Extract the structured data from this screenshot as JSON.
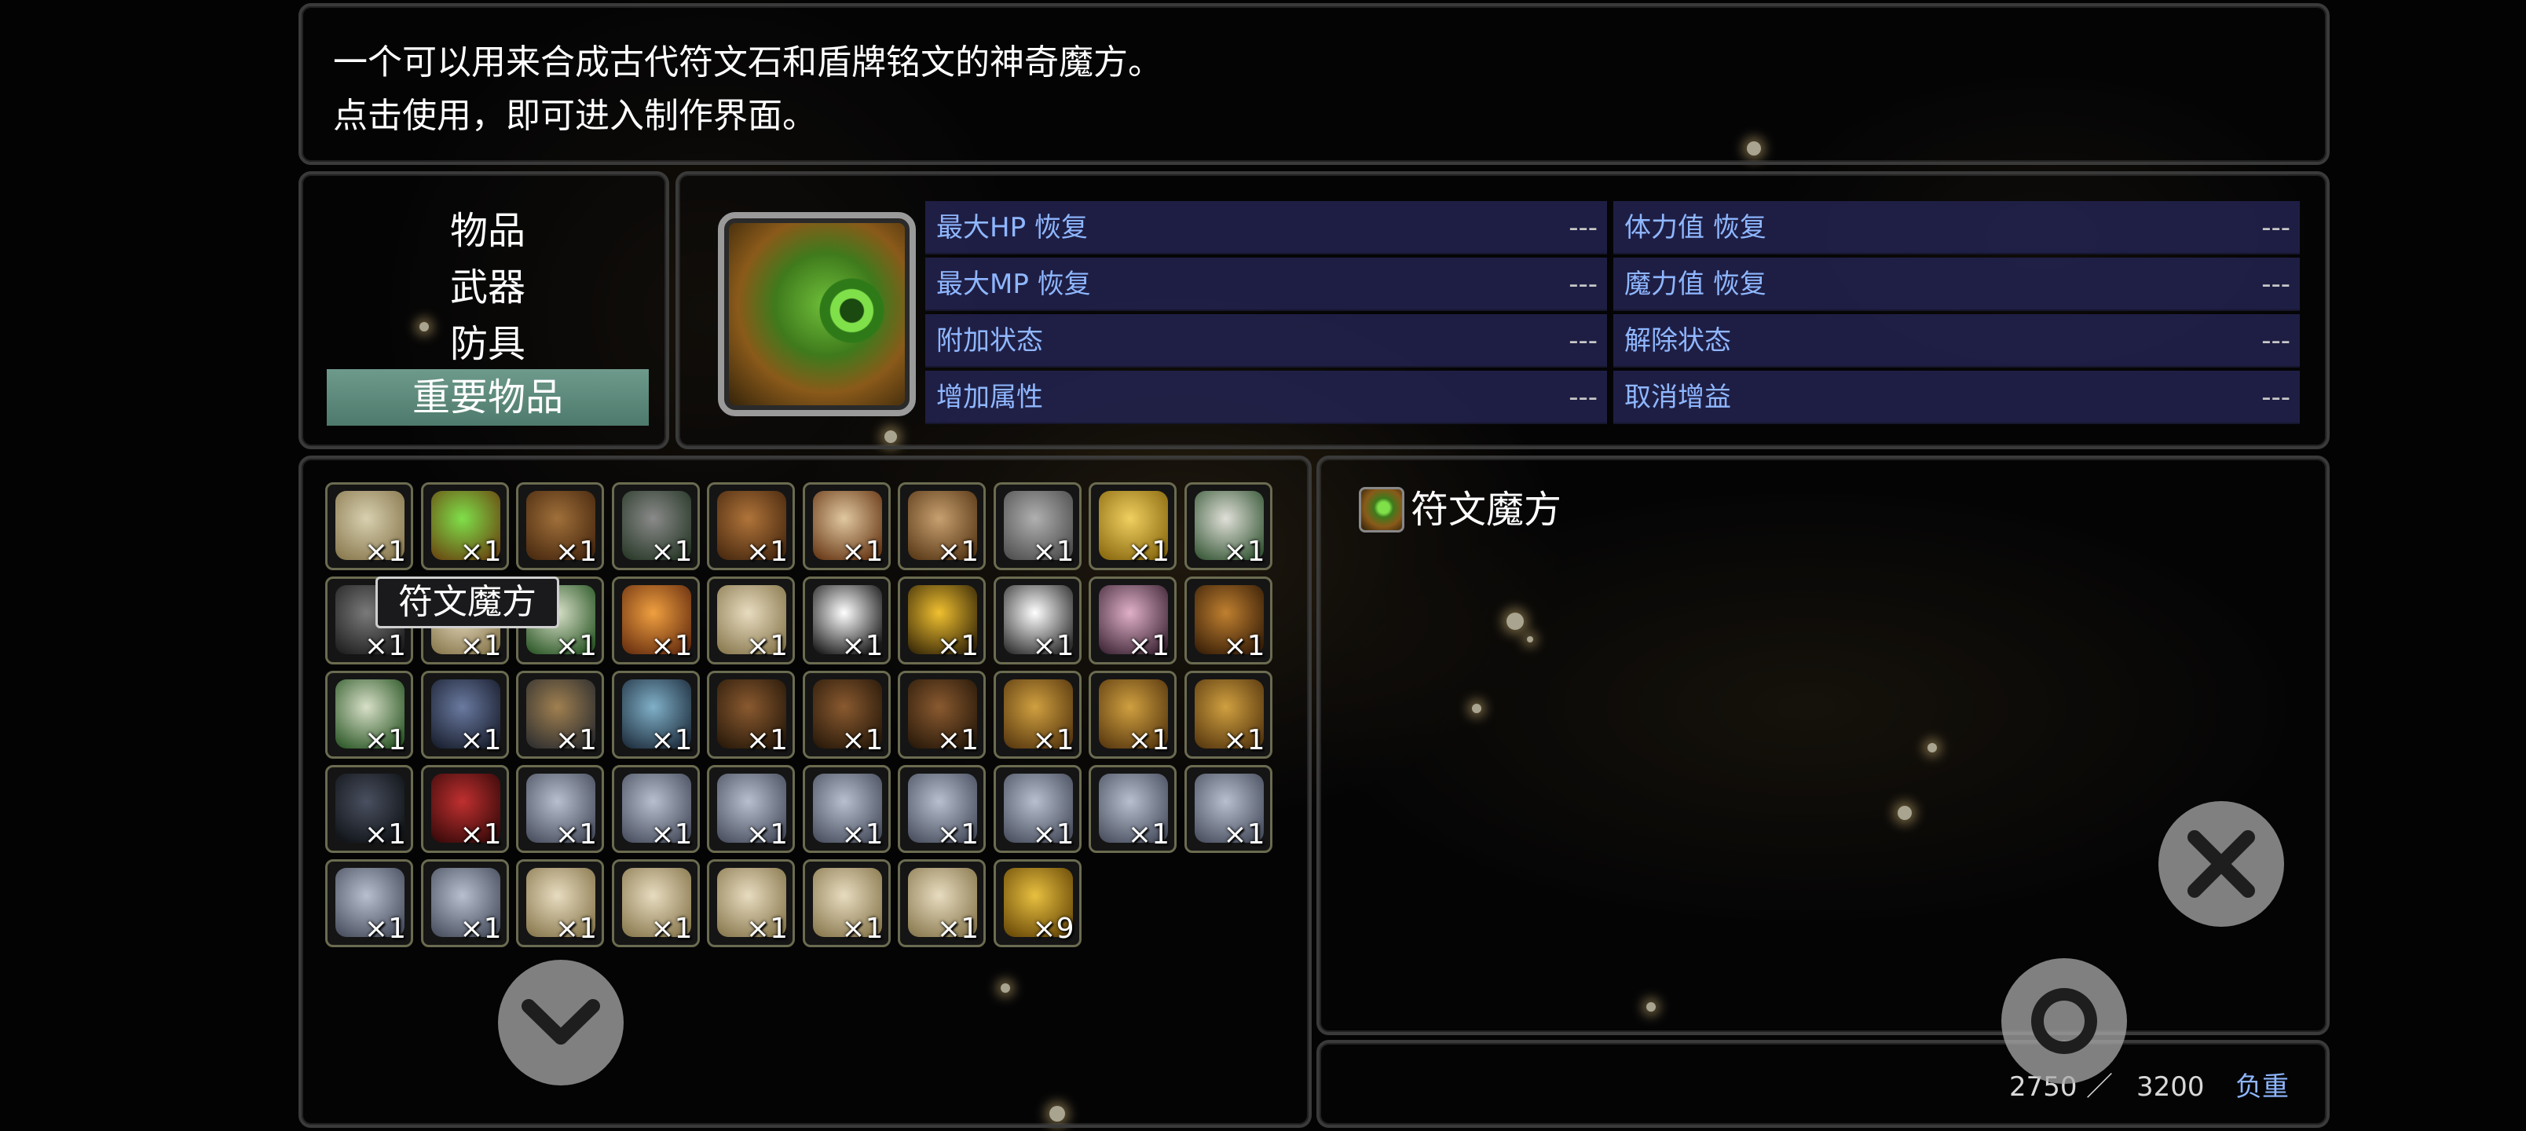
{
  "description": {
    "line1": "一个可以用来合成古代符文石和盾牌铭文的神奇魔方。",
    "line2": "点击使用，即可进入制作界面。"
  },
  "categories": [
    {
      "label": "物品",
      "active": false
    },
    {
      "label": "武器",
      "active": false
    },
    {
      "label": "防具",
      "active": false
    },
    {
      "label": "重要物品",
      "active": true
    }
  ],
  "stats": {
    "left": [
      {
        "label": "最大HP 恢复",
        "value": "---"
      },
      {
        "label": "最大MP 恢复",
        "value": "---"
      },
      {
        "label": "附加状态",
        "value": "---"
      },
      {
        "label": "增加属性",
        "value": "---"
      }
    ],
    "right": [
      {
        "label": "体力值 恢复",
        "value": "---"
      },
      {
        "label": "魔力值 恢复",
        "value": "---"
      },
      {
        "label": "解除状态",
        "value": "---"
      },
      {
        "label": "取消增益",
        "value": "---"
      }
    ]
  },
  "tooltip": "符文魔方",
  "selected_item": {
    "name": "符文魔方",
    "icon": "rune-cube-icon"
  },
  "inventory": [
    {
      "icon": "map-icon",
      "count": "×1"
    },
    {
      "icon": "rune-cube-icon",
      "count": "×1"
    },
    {
      "icon": "jar-icon",
      "count": "×1"
    },
    {
      "icon": "pickaxe-icon",
      "count": "×1"
    },
    {
      "icon": "pouch-icon",
      "count": "×1"
    },
    {
      "icon": "feather-quill-icon",
      "count": "×1"
    },
    {
      "icon": "letter-icon",
      "count": "×1"
    },
    {
      "icon": "stone-tablet-icon",
      "count": "×1"
    },
    {
      "icon": "gold-bar-icon",
      "count": "×1"
    },
    {
      "icon": "paper-icon",
      "count": "×1"
    },
    {
      "icon": "spiked-ball-icon",
      "count": "×1"
    },
    {
      "icon": "scroll-icon",
      "count": "×1"
    },
    {
      "icon": "green-paper-icon",
      "count": "×1"
    },
    {
      "icon": "fire-crystal-icon",
      "count": "×1"
    },
    {
      "icon": "scroll-icon",
      "count": "×1"
    },
    {
      "icon": "candle-icon",
      "count": "×1"
    },
    {
      "icon": "key-icon",
      "count": "×1"
    },
    {
      "icon": "feather-icon",
      "count": "×1"
    },
    {
      "icon": "moon-icon",
      "count": "×1"
    },
    {
      "icon": "flask-icon",
      "count": "×1"
    },
    {
      "icon": "green-paper-icon",
      "count": "×1"
    },
    {
      "icon": "blue-book-icon",
      "count": "×1"
    },
    {
      "icon": "lute-icon",
      "count": "×1"
    },
    {
      "icon": "ice-book-icon",
      "count": "×1"
    },
    {
      "icon": "brown-book-icon",
      "count": "×1"
    },
    {
      "icon": "brown-book-icon",
      "count": "×1"
    },
    {
      "icon": "brown-book-icon",
      "count": "×1"
    },
    {
      "icon": "gold-book-icon",
      "count": "×1"
    },
    {
      "icon": "gold-book-icon",
      "count": "×1"
    },
    {
      "icon": "gold-book-icon",
      "count": "×1"
    },
    {
      "icon": "dark-book-icon",
      "count": "×1"
    },
    {
      "icon": "red-book-icon",
      "count": "×1"
    },
    {
      "icon": "silver-book-icon",
      "count": "×1"
    },
    {
      "icon": "silver-book-icon",
      "count": "×1"
    },
    {
      "icon": "silver-book-icon",
      "count": "×1"
    },
    {
      "icon": "silver-book-icon",
      "count": "×1"
    },
    {
      "icon": "silver-book-icon",
      "count": "×1"
    },
    {
      "icon": "silver-book-icon",
      "count": "×1"
    },
    {
      "icon": "silver-book-icon",
      "count": "×1"
    },
    {
      "icon": "silver-book-icon",
      "count": "×1"
    },
    {
      "icon": "silver-book-icon",
      "count": "×1"
    },
    {
      "icon": "silver-book-icon",
      "count": "×1"
    },
    {
      "icon": "scroll-icon",
      "count": "×1"
    },
    {
      "icon": "scroll-icon",
      "count": "×1"
    },
    {
      "icon": "scroll-icon",
      "count": "×1"
    },
    {
      "icon": "scroll-icon",
      "count": "×1"
    },
    {
      "icon": "scroll-icon",
      "count": "×1"
    },
    {
      "icon": "gold-coin-icon",
      "count": "×9"
    }
  ],
  "weight": {
    "current": "2750",
    "separator": "／",
    "max": "3200",
    "label": "负重"
  },
  "colors": {
    "accent": "#8fb7ff",
    "active_category": "#5f8c7e",
    "stat_bg": "#23235a",
    "slot_border": "#6b6b50"
  }
}
